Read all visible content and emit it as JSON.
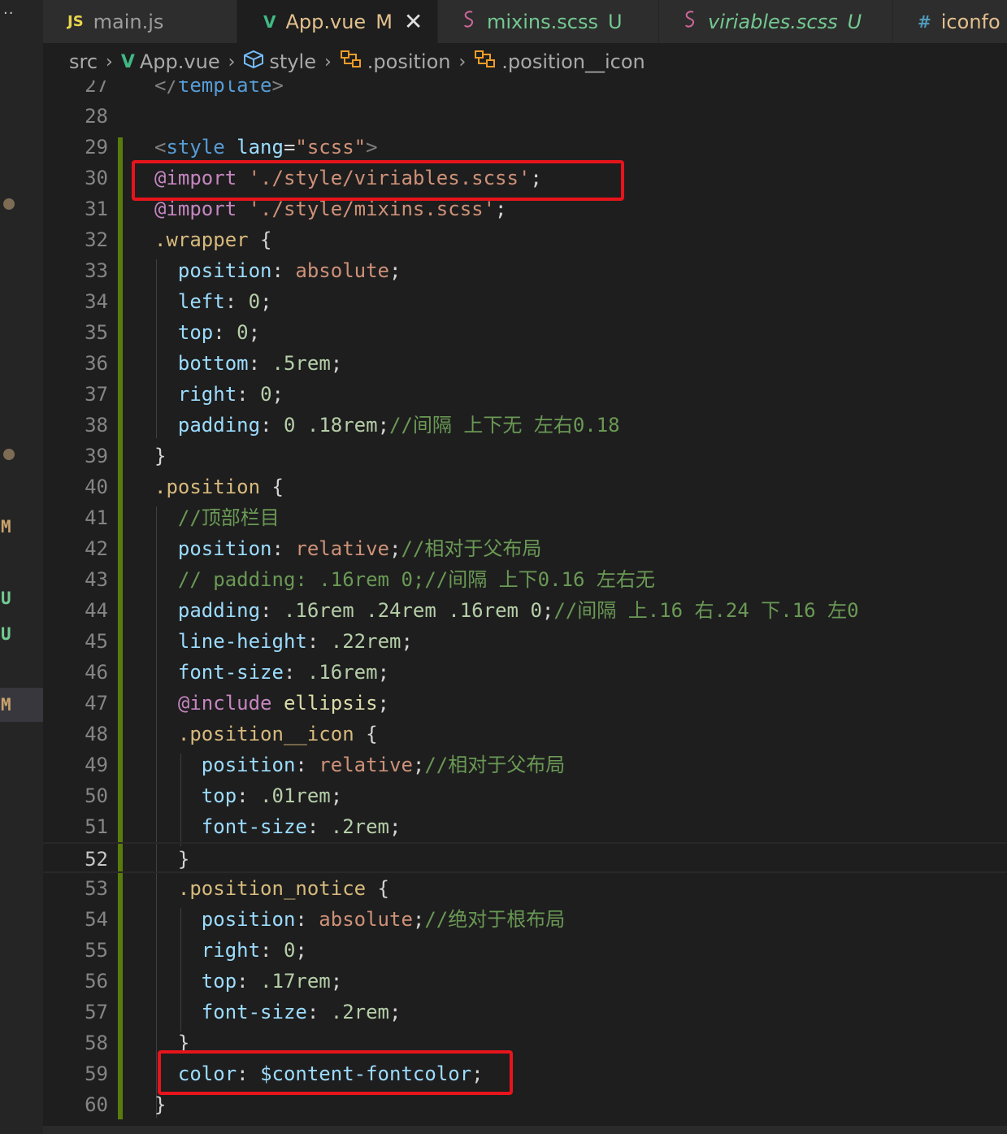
{
  "activity": {
    "dots": "··",
    "marks": [
      {
        "label": "M",
        "color": "#c9a26d"
      },
      {
        "label": "U",
        "color": "#73c991"
      },
      {
        "label": "U",
        "color": "#73c991"
      },
      {
        "label": "M",
        "color": "#c9a26d"
      }
    ]
  },
  "tabs": [
    {
      "icon": "JS",
      "name": "main.js",
      "status": "",
      "active": false,
      "icon_color": "#e8d44d",
      "name_color": "#9d9d9d"
    },
    {
      "icon": "V",
      "name": "App.vue",
      "status": "M",
      "active": true,
      "icon_color": "#41b883",
      "name_color": "#e2c08d",
      "close": "✕"
    },
    {
      "icon": "S",
      "name": "mixins.scss",
      "status": "U",
      "active": false,
      "icon_color": "#cd6799",
      "name_color": "#73c991"
    },
    {
      "icon": "S",
      "name": "viriables.scss",
      "status": "U",
      "active": false,
      "icon_color": "#cd6799",
      "name_color": "#73c991",
      "italic": true
    },
    {
      "icon": "#",
      "name": "iconfo",
      "status": "",
      "active": false,
      "icon_color": "#519aba",
      "name_color": "#e2c08d"
    }
  ],
  "breadcrumbs": [
    "src",
    "App.vue",
    "style",
    ".position",
    ".position__icon"
  ],
  "editor": {
    "current_line": "52",
    "line_numbers": [
      "27",
      "28",
      "29",
      "30",
      "31",
      "32",
      "33",
      "34",
      "35",
      "36",
      "37",
      "38",
      "39",
      "40",
      "41",
      "42",
      "43",
      "44",
      "45",
      "46",
      "47",
      "48",
      "49",
      "50",
      "51",
      "52",
      "53",
      "54",
      "55",
      "56",
      "57",
      "58",
      "59",
      "60"
    ],
    "lines": [
      "</template>",
      "",
      "<style lang=\"scss\">",
      "@import './style/viriables.scss';",
      "@import './style/mixins.scss';",
      ".wrapper {",
      "  position: absolute;",
      "  left: 0;",
      "  top: 0;",
      "  bottom: .5rem;",
      "  right: 0;",
      "  padding: 0 .18rem;//间隔 上下无 左右0.18",
      "}",
      ".position {",
      "  //顶部栏目",
      "  position: relative;//相对于父布局",
      "  // padding: .16rem 0;//间隔 上下0.16 左右无",
      "  padding: .16rem .24rem .16rem 0;//间隔 上.16 右.24 下.16 左0",
      "  line-height: .22rem;",
      "  font-size: .16rem;",
      "  @include ellipsis;",
      "  .position__icon {",
      "    position: relative;//相对于父布局",
      "    top: .01rem;",
      "    font-size: .2rem;",
      "  }",
      "  .position_notice {",
      "    position: absolute;//绝对于根布局",
      "    right: 0;",
      "    top: .17rem;",
      "    font-size: .2rem;",
      "  }",
      "  color: $content-fontcolor;",
      "}"
    ]
  },
  "colors": {
    "highlight_box": "#e8141c",
    "modified_gutter": "#587c0c"
  }
}
